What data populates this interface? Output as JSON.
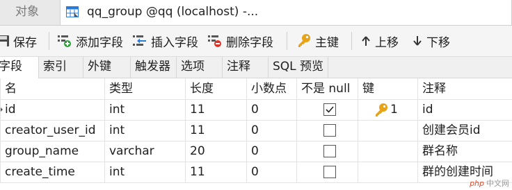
{
  "tabs": {
    "objects_label": "对象",
    "active_label": "qq_group @qq (localhost) -..."
  },
  "toolbar": {
    "save": "保存",
    "add_field": "添加字段",
    "insert_field": "插入字段",
    "delete_field": "删除字段",
    "primary_key": "主键",
    "move_up": "上移",
    "move_down": "下移"
  },
  "subtabs": [
    "字段",
    "索引",
    "外键",
    "触发器",
    "选项",
    "注释",
    "SQL 预览"
  ],
  "columns": {
    "name": "名",
    "type": "类型",
    "length": "长度",
    "decimals": "小数点",
    "not_null": "不是 null",
    "key": "键",
    "comment": "注释"
  },
  "fields": [
    {
      "name": "id",
      "type": "int",
      "length": "11",
      "decimals": "0",
      "not_null": true,
      "key": "1",
      "comment": "id"
    },
    {
      "name": "creator_user_id",
      "type": "int",
      "length": "11",
      "decimals": "0",
      "not_null": false,
      "key": "",
      "comment": "创建会员id"
    },
    {
      "name": "group_name",
      "type": "varchar",
      "length": "20",
      "decimals": "0",
      "not_null": false,
      "key": "",
      "comment": "群名称"
    },
    {
      "name": "create_time",
      "type": "int",
      "length": "11",
      "decimals": "0",
      "not_null": false,
      "key": "",
      "comment": "群的创建时间"
    }
  ],
  "watermark": {
    "logo": "php",
    "text": "中文网"
  },
  "colors": {
    "key_icon": "#e8a317",
    "add_icon": "#2e9e3a",
    "delete_icon": "#d9362b",
    "tab_icon": "#2b7bd6"
  }
}
